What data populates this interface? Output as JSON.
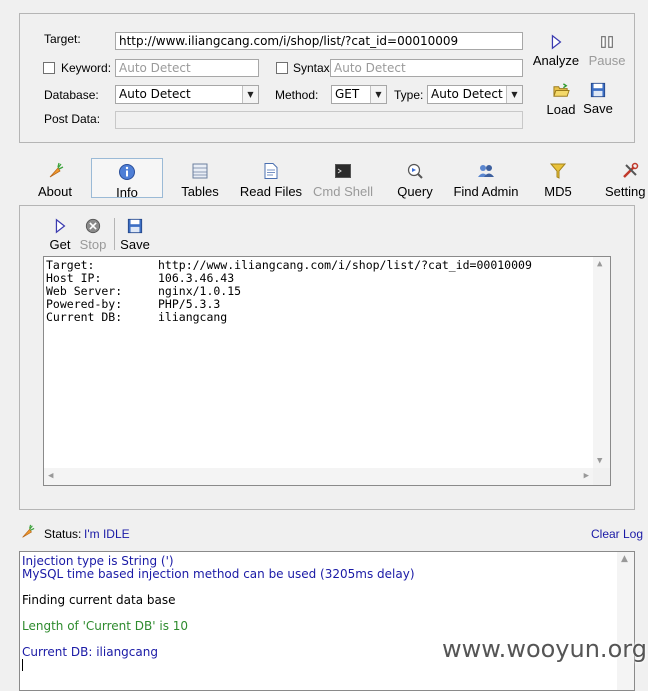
{
  "target_panel": {
    "target_label": "Target:",
    "target_value": "http://www.iliangcang.com/i/shop/list/?cat_id=00010009",
    "keyword_label": "Keyword:",
    "keyword_placeholder": "Auto Detect",
    "syntax_label": "Syntax:",
    "syntax_placeholder": "Auto Detect",
    "database_label": "Database:",
    "database_value": "Auto Detect",
    "method_label": "Method:",
    "method_value": "GET",
    "type_label": "Type:",
    "type_value": "Auto Detect",
    "postdata_label": "Post Data:",
    "analyze_label": "Analyze",
    "pause_label": "Pause",
    "load_label": "Load",
    "save_label": "Save"
  },
  "tabs": [
    {
      "label": "About",
      "icon": "carrot-icon"
    },
    {
      "label": "Info",
      "icon": "info-icon"
    },
    {
      "label": "Tables",
      "icon": "table-icon"
    },
    {
      "label": "Read Files",
      "icon": "file-icon"
    },
    {
      "label": "Cmd Shell",
      "icon": "terminal-icon"
    },
    {
      "label": "Query",
      "icon": "query-icon"
    },
    {
      "label": "Find Admin",
      "icon": "users-icon"
    },
    {
      "label": "MD5",
      "icon": "funnel-icon"
    },
    {
      "label": "Setting",
      "icon": "tools-icon"
    }
  ],
  "info_toolbar": {
    "get_label": "Get",
    "stop_label": "Stop",
    "save_label": "Save"
  },
  "info_rows": [
    {
      "key": "Target:",
      "value": "http://www.iliangcang.com/i/shop/list/?cat_id=00010009"
    },
    {
      "key": "Host IP:",
      "value": "106.3.46.43"
    },
    {
      "key": "Web Server:",
      "value": "nginx/1.0.15"
    },
    {
      "key": "Powered-by:",
      "value": "PHP/5.3.3"
    },
    {
      "key": "Current DB:",
      "value": "iliangcang"
    }
  ],
  "status": {
    "label": "Status:",
    "value": "I'm IDLE",
    "clear_log": "Clear Log"
  },
  "log_lines": [
    {
      "text": "Injection type is String (')",
      "color": "#1a1aa6"
    },
    {
      "text": "MySQL time based injection method can be used (3205ms delay)",
      "color": "#1a1aa6"
    },
    {
      "text": "Finding current data base",
      "color": "#000000"
    },
    {
      "text": "Length of 'Current DB' is 10",
      "color": "#2e8b2e"
    },
    {
      "text": "Current DB: iliangcang",
      "color": "#1a1aa6"
    }
  ],
  "watermark": "www.wooyun.org",
  "colors": {
    "link_blue": "#1a1aa6",
    "active_tab_border": "#9bbad6"
  }
}
